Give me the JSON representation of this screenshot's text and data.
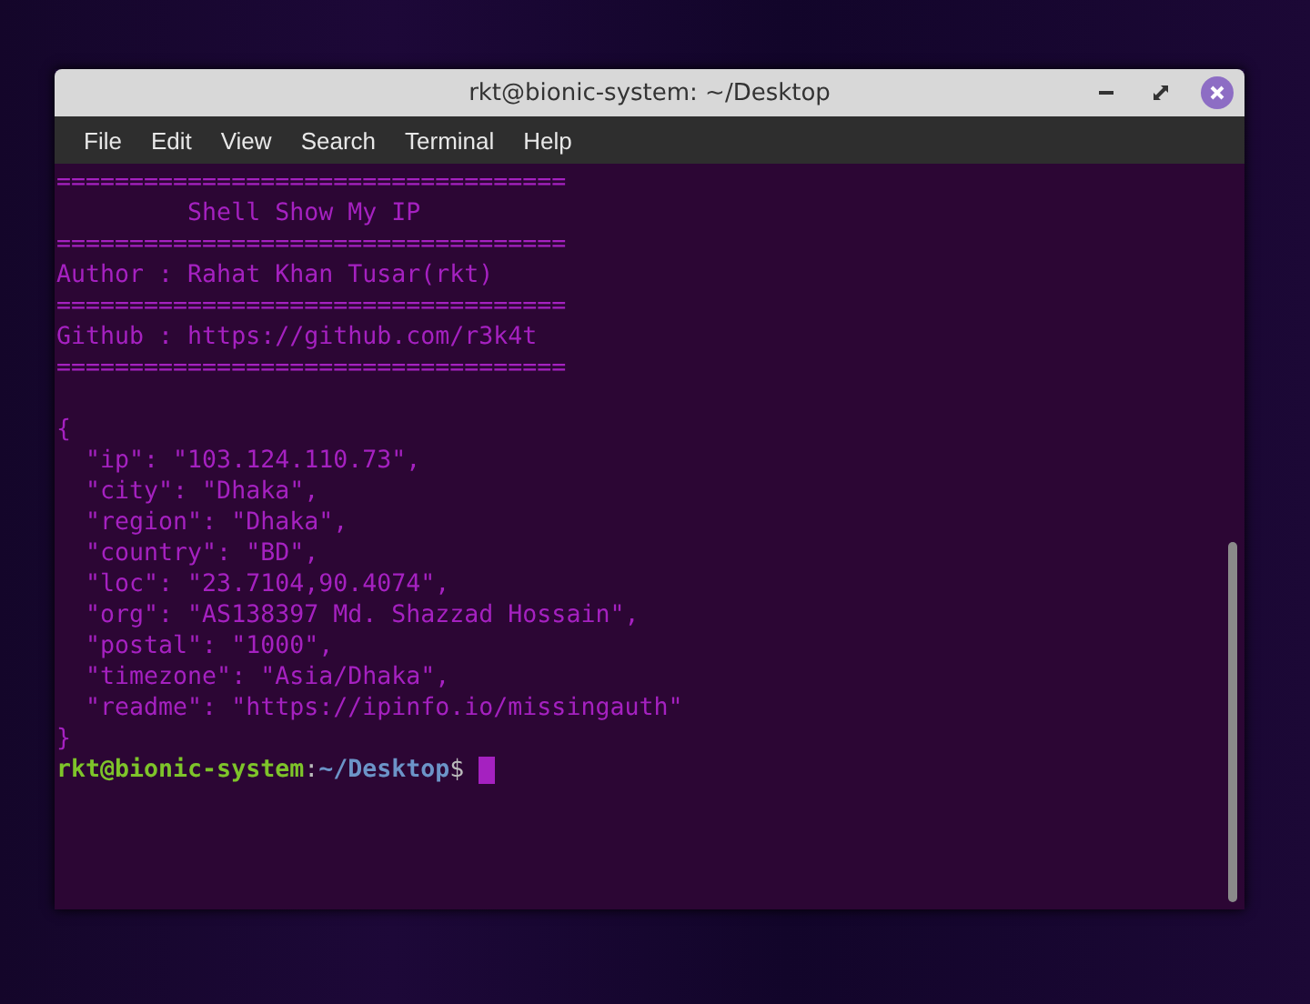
{
  "window": {
    "title": "rkt@bionic-system: ~/Desktop"
  },
  "menu": [
    "File",
    "Edit",
    "View",
    "Search",
    "Terminal",
    "Help"
  ],
  "terminal": {
    "lines": [
      "===================================",
      "         Shell Show My IP",
      "===================================",
      "Author : Rahat Khan Tusar(rkt)",
      "===================================",
      "Github : https://github.com/r3k4t",
      "==================================="
    ],
    "json_lines": [
      "{",
      "  \"ip\": \"103.124.110.73\",",
      "  \"city\": \"Dhaka\",",
      "  \"region\": \"Dhaka\",",
      "  \"country\": \"BD\",",
      "  \"loc\": \"23.7104,90.4074\",",
      "  \"org\": \"AS138397 Md. Shazzad Hossain\",",
      "  \"postal\": \"1000\",",
      "  \"timezone\": \"Asia/Dhaka\",",
      "  \"readme\": \"https://ipinfo.io/missingauth\"",
      "}"
    ],
    "prompt": {
      "user_host": "rkt@bionic-system",
      "separator": ":",
      "path": "~/Desktop",
      "symbol": "$"
    }
  }
}
